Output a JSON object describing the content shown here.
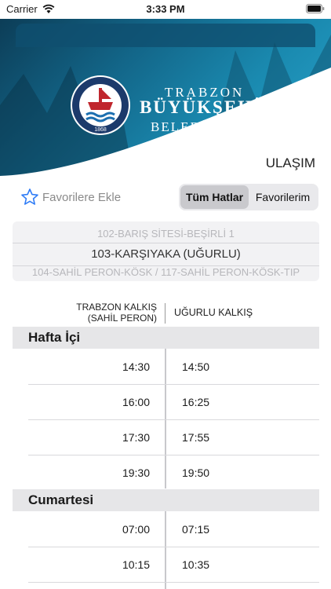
{
  "status_bar": {
    "carrier": "Carrier",
    "time": "3:33 PM"
  },
  "banner": {
    "logo_text": "TRABZON BÜYÜKŞEHİR BELEDİYESİ",
    "logo_year": "1868",
    "brand_line1": "TRABZON",
    "brand_line2": "BÜYÜKŞEHİR",
    "brand_line3": "BELEDİYESİ",
    "colors": {
      "primary": "#13678a",
      "light": "#2aa4cc"
    }
  },
  "page_title": "ULAŞIM",
  "favorites": {
    "add_label": "Favorilere Ekle",
    "icon": "star-icon",
    "accent": "#2f7cf6"
  },
  "segment": {
    "options": [
      "Tüm Hatlar",
      "Favorilerim"
    ],
    "selected": "Tüm Hatlar"
  },
  "route_picker": {
    "previous": "102-BARIŞ SİTESİ-BEŞİRLİ 1",
    "selected": "103-KARŞIYAKA (UĞURLU)",
    "next": "104-SAHİL PERON-KÖSK / 117-SAHİL PERON-KÖSK-TIP"
  },
  "timetable": {
    "left_header_line1": "TRABZON KALKIŞ",
    "left_header_line2": "(SAHİL PERON)",
    "right_header": "UĞURLU KALKIŞ",
    "groups": [
      {
        "title": "Hafta İçi",
        "rows": [
          {
            "left": "14:30",
            "right": "14:50"
          },
          {
            "left": "16:00",
            "right": "16:25"
          },
          {
            "left": "17:30",
            "right": "17:55"
          },
          {
            "left": "19:30",
            "right": "19:50"
          }
        ]
      },
      {
        "title": "Cumartesi",
        "rows": [
          {
            "left": "07:00",
            "right": "07:15"
          },
          {
            "left": "10:15",
            "right": "10:35"
          }
        ]
      }
    ]
  }
}
